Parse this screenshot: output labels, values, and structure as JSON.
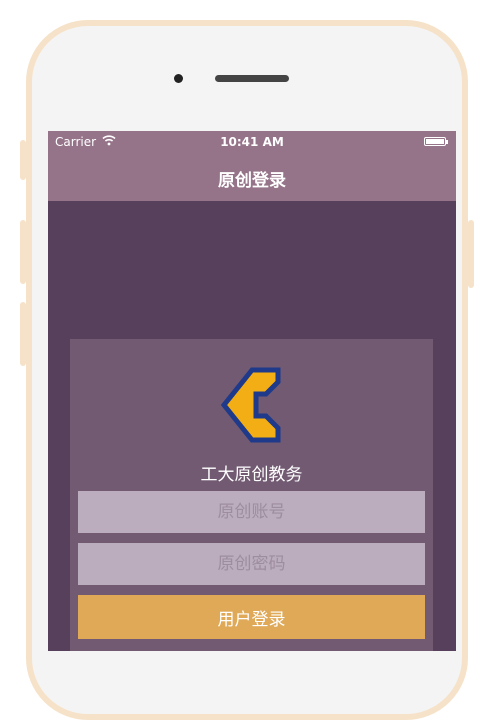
{
  "status_bar": {
    "carrier": "Carrier",
    "time": "10:41 AM"
  },
  "navbar": {
    "title": "原创登录"
  },
  "login": {
    "app_name": "工大原创教务",
    "account_placeholder": "原创账号",
    "password_placeholder": "原创密码",
    "login_label": "用户登录"
  },
  "colors": {
    "navbar": "#957389",
    "background": "#56405c",
    "card": "#725b72",
    "input": "#bbadbd",
    "button": "#dfa958",
    "logo_fill": "#f3ae16",
    "logo_stroke": "#1f3a8a"
  },
  "icons": [
    "wifi-icon",
    "battery-icon",
    "app-logo-icon"
  ]
}
